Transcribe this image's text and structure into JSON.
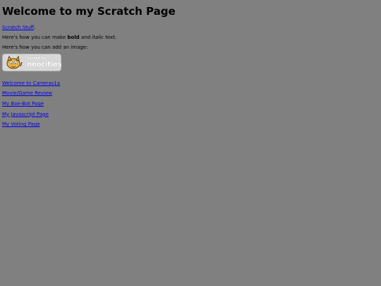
{
  "header": {
    "title": "Welcome to my Scratch Page"
  },
  "intro": {
    "scratch_link": "Scratch Stuff",
    "scratch_link_suffix": ".",
    "bold_prefix": "Here's how you can make ",
    "bold_word": "bold",
    "bold_middle": " and ",
    "italic_word": "italic",
    "bold_suffix": " text.",
    "image_text": "Here's how you can add an image:"
  },
  "badge": {
    "small_text": "hosted by",
    "big_text": "neocities",
    "icon": "neocities-cat-icon"
  },
  "links": [
    "Welcome to Carreras1a",
    "Movie/Game Review",
    "My Boe-Bot Page",
    "My Javascript Page",
    "My Voting Page"
  ],
  "colors": {
    "background": "#808080",
    "link": "#0000EE",
    "text": "#000000"
  }
}
